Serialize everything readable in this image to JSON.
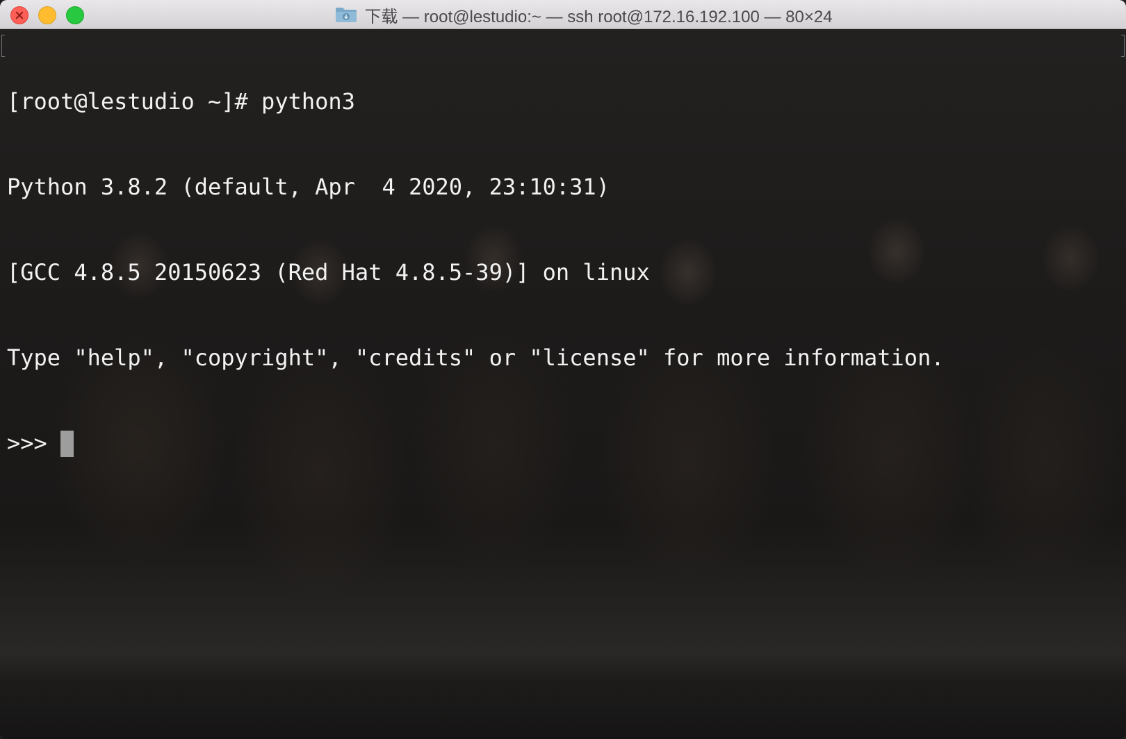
{
  "window": {
    "title": "下载 — root@lestudio:~ — ssh root@172.16.192.100 — 80×24",
    "title_icon": "folder-icon",
    "controls": [
      "close",
      "minimize",
      "zoom"
    ]
  },
  "terminal": {
    "lines": [
      "[root@lestudio ~]# python3",
      "Python 3.8.2 (default, Apr  4 2020, 23:10:31)",
      "[GCC 4.8.5 20150623 (Red Hat 4.8.5-39)] on linux",
      "Type \"help\", \"copyright\", \"credits\" or \"license\" for more information."
    ],
    "prompt": ">>> ",
    "text_color": "#f2f2f2",
    "cursor_color": "#9d9d9d"
  }
}
